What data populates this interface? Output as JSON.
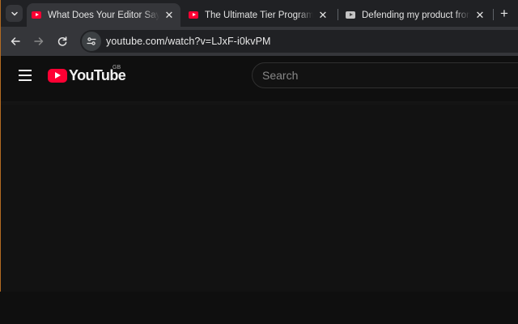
{
  "browser": {
    "tabs": [
      {
        "title": "What Does Your Editor Say Abo",
        "active": true
      },
      {
        "title": "The Ultimate Tier Programming",
        "active": false
      },
      {
        "title": "Defending my product from the",
        "active": false
      }
    ],
    "close_glyph": "✕",
    "new_tab_glyph": "+",
    "url": "youtube.com/watch?v=LJxF-i0kvPM"
  },
  "youtube": {
    "logo_text": "YouTube",
    "region": "GB",
    "search_placeholder": "Search"
  },
  "colors": {
    "accent_frame": "#b36b22",
    "youtube_red": "#ff0033"
  }
}
